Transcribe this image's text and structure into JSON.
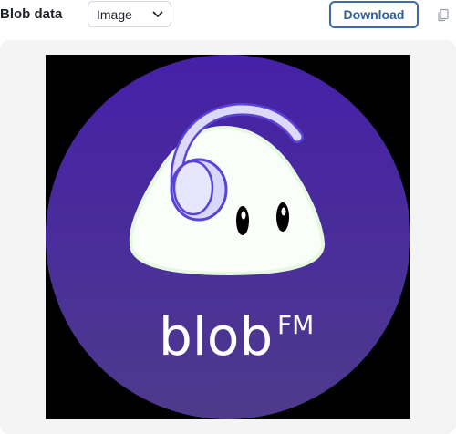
{
  "header": {
    "title": "Blob data",
    "view_select": {
      "value": "Image"
    },
    "download_label": "Download",
    "copy_icon": "copy-icon"
  },
  "preview": {
    "logo": {
      "wordmark": "blob",
      "superscript": "FM",
      "colors": {
        "background_top": "#4520a8",
        "background_bottom": "#4e3a8c",
        "blob_fill": "#fafef8",
        "headphone_fill": "#d9d6fb",
        "headphone_stroke": "#5b43d6",
        "eye_fill": "#000000",
        "text": "#ffffff"
      }
    }
  }
}
